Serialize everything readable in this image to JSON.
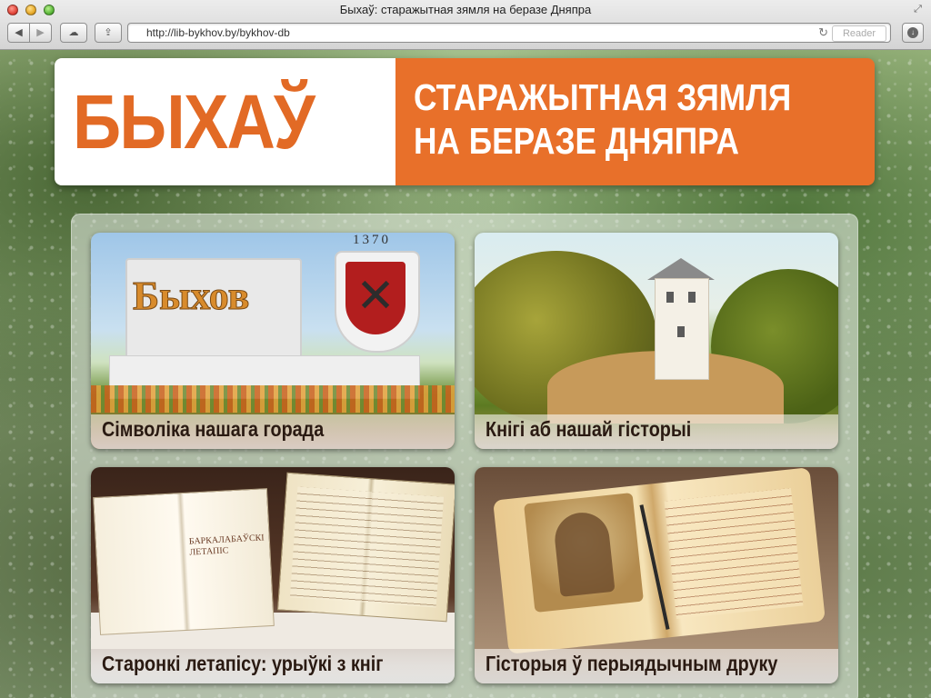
{
  "window": {
    "title": "Быхаў: старажытная зямля на беразе Дняпра"
  },
  "toolbar": {
    "back_icon": "◀",
    "forward_icon": "▶",
    "icloud_icon": "☁",
    "share_icon": "⇪",
    "url": "http://lib-bykhov.by/bykhov-db",
    "reload_icon": "↻",
    "reader_label": "Reader",
    "download_icon": "↓"
  },
  "banner": {
    "brand": "БЫХАЎ",
    "subtitle_line1": "СТАРАЖЫТНАЯ ЗЯМЛЯ",
    "subtitle_line2": "НА БЕРАЗЕ ДНЯПРА"
  },
  "tiles": [
    {
      "caption": "Сімволіка нашага горада",
      "sign_text": "Быхов",
      "year": "1370"
    },
    {
      "caption": "Кнігі аб нашай гісторыі"
    },
    {
      "caption": "Старонкі летапісу: урыўкі з кніг",
      "book_title": "БАРКАЛАБАЎСКІ ЛЕТАПІС"
    },
    {
      "caption": "Гісторыя ў перыядычным друку"
    }
  ],
  "colors": {
    "accent_orange": "#e8702a",
    "brand_orange": "#e26a25",
    "caption_text": "#2a1a12"
  }
}
